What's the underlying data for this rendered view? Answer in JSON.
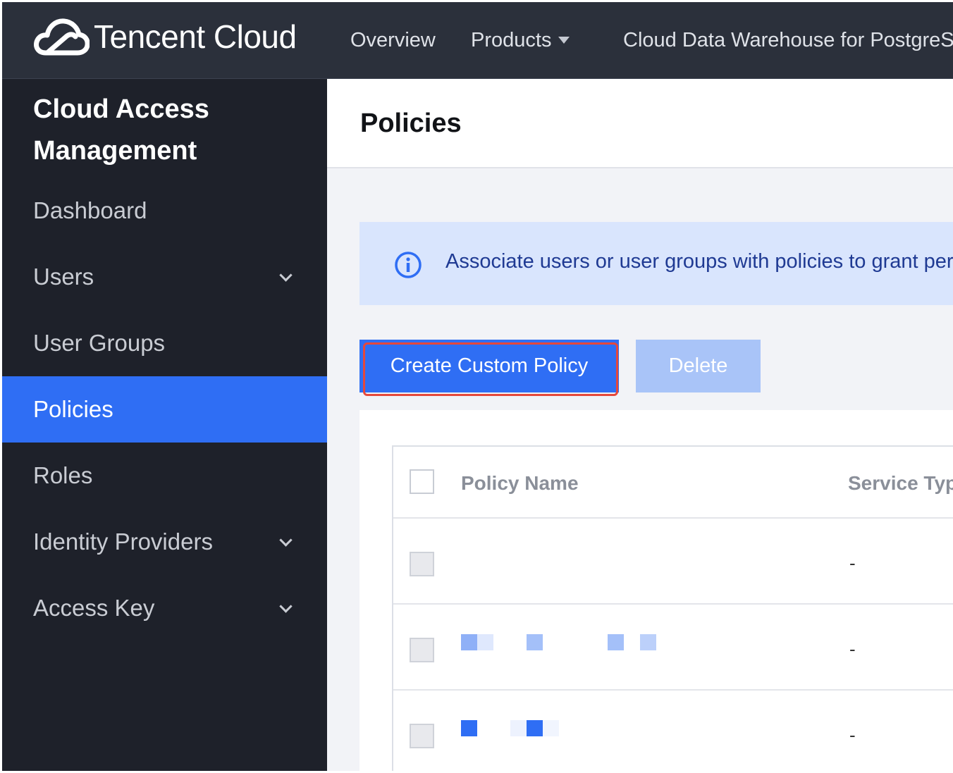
{
  "topbar": {
    "brand": "Tencent Cloud",
    "nav": {
      "overview": "Overview",
      "products": "Products",
      "service": "Cloud Data Warehouse for PostgreSQ"
    },
    "icons": {
      "logo": "tencent-cloud-logo",
      "products_caret": "caret-down-icon"
    }
  },
  "sidebar": {
    "title_line1": "Cloud Access",
    "title_line2": "Management",
    "items": [
      {
        "label": "Dashboard",
        "expandable": false,
        "active": false
      },
      {
        "label": "Users",
        "expandable": true,
        "active": false
      },
      {
        "label": "User Groups",
        "expandable": false,
        "active": false
      },
      {
        "label": "Policies",
        "expandable": false,
        "active": true
      },
      {
        "label": "Roles",
        "expandable": false,
        "active": false
      },
      {
        "label": "Identity Providers",
        "expandable": true,
        "active": false
      },
      {
        "label": "Access Key",
        "expandable": true,
        "active": false
      }
    ]
  },
  "main": {
    "page_title": "Policies",
    "notice": {
      "icon": "info-icon",
      "text": "Associate users or user groups with policies to grant perm"
    },
    "toolbar": {
      "create_label": "Create Custom Policy",
      "delete_label": "Delete"
    },
    "table": {
      "columns": [
        "Policy Name",
        "Service Typ"
      ],
      "rows": [
        {
          "service_type": "-"
        },
        {
          "service_type": "-"
        },
        {
          "service_type": "-"
        }
      ]
    }
  },
  "colors": {
    "topbar_bg": "#2b303b",
    "sidebar_bg": "#1e212a",
    "accent": "#2f6ef4",
    "highlight_border": "#e5483c",
    "notice_bg": "#d9e5fd"
  }
}
